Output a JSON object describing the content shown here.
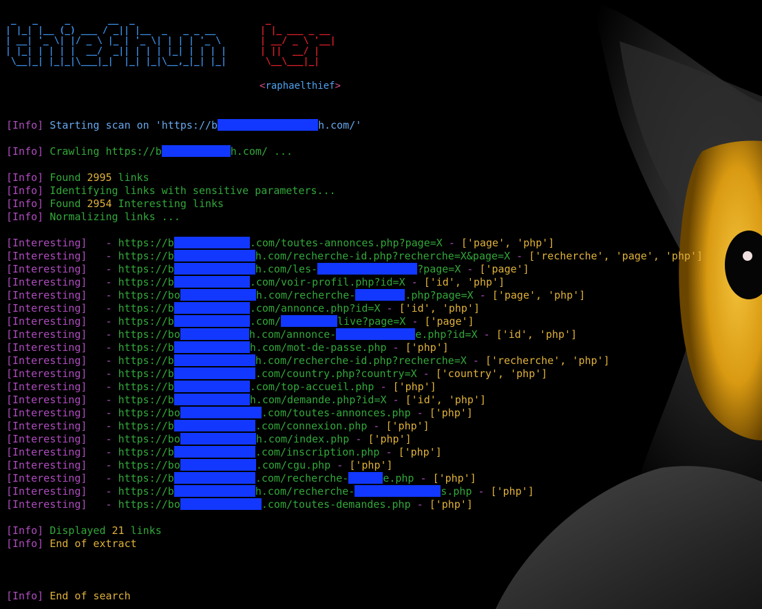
{
  "banner": {
    "blue_art": " _   _     _       __  _\n| |_| |__ (_) ___ / _|| |__  _   _ _ __\n| __| '_ \\| |/ _ \\ |_ | '_ \\| | | | '_ \\\n| |_| | | | |  __/  _|| | | | |_| | | | |\n \\__|_| |_|_|\\___|_|  |_| |_|\\__,_|_| |_|",
    "red_art": " _\n| |_ ___ _ __\n| __/ _ \\ '__|\n| ||  __/ |\n \\__\\___|_|",
    "author_open": "<",
    "author_name": "raphaelthief",
    "author_close": ">"
  },
  "colors": {
    "background": "#000000",
    "info_tag": "#b04cc0",
    "green_text": "#32a83a",
    "yellow_text": "#e0b23a",
    "blue_text": "#67a9ee",
    "redaction": "#1238ff"
  },
  "log": {
    "start": {
      "tag": "[Info]",
      "text": "Starting scan on 'https://b",
      "tail": "h.com/'"
    },
    "crawl": {
      "tag": "[Info]",
      "text": "Crawling https://b",
      "tail": "h.com/ ..."
    },
    "found": {
      "tag": "[Info]",
      "pre": "Found ",
      "count": "2995",
      "post": " links"
    },
    "identify": {
      "tag": "[Info]",
      "text": "Identifying links with sensitive parameters..."
    },
    "found_interesting": {
      "tag": "[Info]",
      "pre": "Found ",
      "count": "2954",
      "post": " Interesting links"
    },
    "normalize": {
      "tag": "[Info]",
      "text": "Normalizing links ..."
    },
    "displayed": {
      "tag": "[Info]",
      "pre": "Displayed ",
      "count": "21",
      "post": " links"
    },
    "end_extract": {
      "tag": "[Info]",
      "text": "End of extract"
    },
    "end_search": {
      "tag": "[Info]",
      "text": "End of search"
    }
  },
  "interesting_tag": "[Interesting]",
  "interesting": [
    {
      "prefix": "https://b",
      "path": ".com/toutes-annonces.php?page=X",
      "params": "['page', 'php']"
    },
    {
      "prefix": "https://b",
      "path": "h.com/recherche-id.php?recherche=X&page=X",
      "params": "['recherche', 'page', 'php']"
    },
    {
      "prefix": "https://b",
      "path": "h.com/les-",
      "path2": "?page=X",
      "params": "['page']"
    },
    {
      "prefix": "https://b",
      "path": ".com/voir-profil.php?id=X",
      "params": "['id', 'php']"
    },
    {
      "prefix": "https://bo",
      "path": "h.com/recherche-",
      "path2": ".php?page=X",
      "params": "['page', 'php']"
    },
    {
      "prefix": "https://b",
      "path": ".com/annonce.php?id=X",
      "params": "['id', 'php']"
    },
    {
      "prefix": "https://b",
      "path": ".com/",
      "path2": "live?page=X",
      "params": "['page']"
    },
    {
      "prefix": "https://bo",
      "path": "h.com/annonce-",
      "path2": "e.php?id=X",
      "params": "['id', 'php']"
    },
    {
      "prefix": "https://b",
      "path": "h.com/mot-de-passe.php",
      "params": "['php']"
    },
    {
      "prefix": "https://b",
      "path": "h.com/recherche-id.php?recherche=X",
      "params": "['recherche', 'php']"
    },
    {
      "prefix": "https://b",
      "path": ".com/country.php?country=X",
      "params": "['country', 'php']"
    },
    {
      "prefix": "https://b",
      "path": ".com/top-accueil.php",
      "params": "['php']"
    },
    {
      "prefix": "https://b",
      "path": "h.com/demande.php?id=X",
      "params": "['id', 'php']"
    },
    {
      "prefix": "https://bo",
      "path": ".com/toutes-annonces.php",
      "params": "['php']"
    },
    {
      "prefix": "https://b",
      "path": ".com/connexion.php",
      "params": "['php']"
    },
    {
      "prefix": "https://bo",
      "path": "h.com/index.php",
      "params": "['php']"
    },
    {
      "prefix": "https://b",
      "path": ".com/inscription.php",
      "params": "['php']"
    },
    {
      "prefix": "https://bo",
      "path": ".com/cgu.php",
      "params": "['php']"
    },
    {
      "prefix": "https://b",
      "path": ".com/recherche-",
      "path2": "e.php",
      "params": "['php']"
    },
    {
      "prefix": "https://b",
      "path": "h.com/recherche-",
      "path2": "s.php",
      "params": "['php']"
    },
    {
      "prefix": "https://bo",
      "path": ".com/toutes-demandes.php",
      "params": "['php']"
    }
  ]
}
